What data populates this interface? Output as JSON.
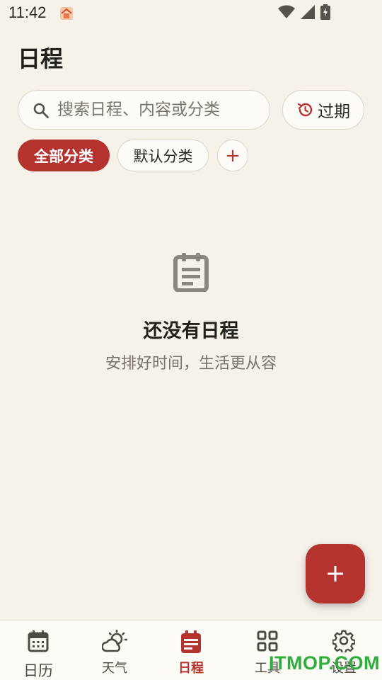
{
  "status_bar": {
    "time": "11:42",
    "app_icon": "calendar-app-notification-icon",
    "icons": [
      "wifi-icon",
      "cellular-signal-icon",
      "battery-charging-icon"
    ]
  },
  "header": {
    "title": "日程"
  },
  "search": {
    "placeholder": "搜索日程、内容或分类",
    "value": "",
    "icon": "search-icon"
  },
  "expired_button": {
    "label": "过期",
    "icon": "history-icon"
  },
  "categories": {
    "items": [
      {
        "label": "全部分类",
        "selected": true
      },
      {
        "label": "默认分类",
        "selected": false
      }
    ],
    "add_symbol": "+"
  },
  "empty_state": {
    "icon": "note-list-icon",
    "title": "还没有日程",
    "subtitle": "安排好时间，生活更从容"
  },
  "fab": {
    "icon": "plus-icon"
  },
  "bottom_nav": {
    "items": [
      {
        "label": "日历",
        "icon": "calendar-icon",
        "active": false
      },
      {
        "label": "天气",
        "icon": "weather-icon",
        "active": false
      },
      {
        "label": "日程",
        "icon": "schedule-icon",
        "active": true
      },
      {
        "label": "工具",
        "icon": "grid-icon",
        "active": false
      },
      {
        "label": "设置",
        "icon": "gear-icon",
        "active": false
      }
    ]
  },
  "watermark": {
    "text": "ITMOP.COM"
  },
  "colors": {
    "background": "#f6f2ea",
    "accent": "#b5332f",
    "text_primary": "#211f1c",
    "text_secondary": "#77726a",
    "watermark": "#2fae3c"
  }
}
